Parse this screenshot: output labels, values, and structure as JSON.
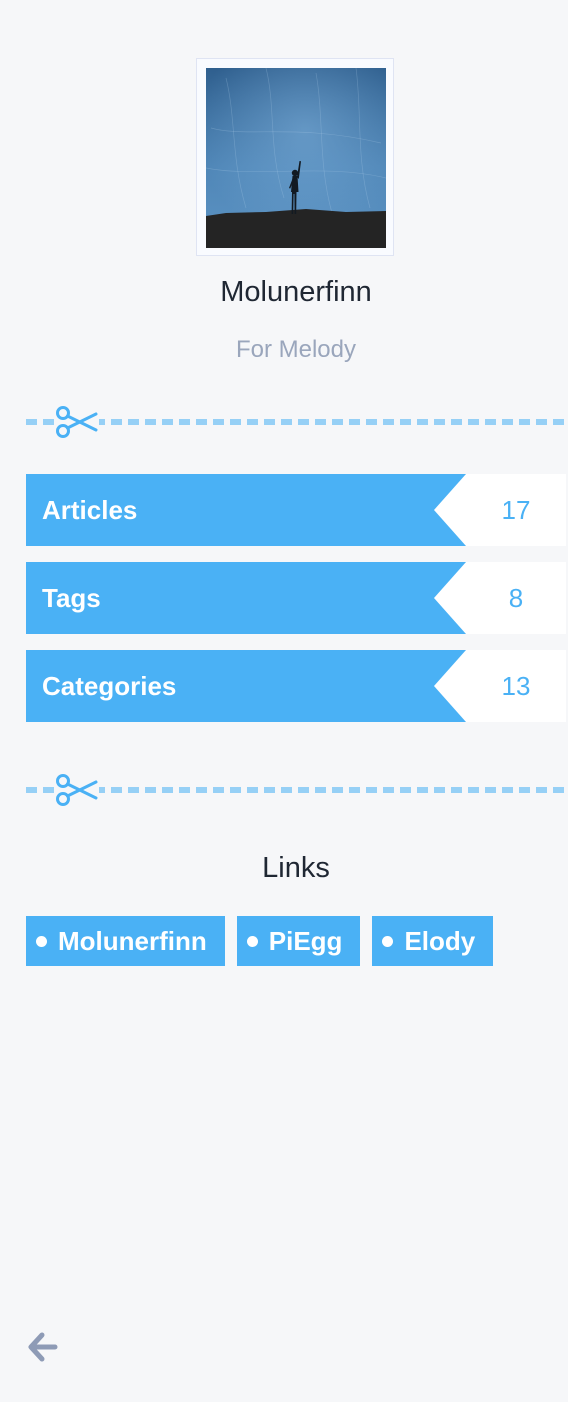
{
  "author": {
    "name": "Molunerfinn",
    "subtitle": "For Melody"
  },
  "stats": [
    {
      "label": "Articles",
      "count": "17"
    },
    {
      "label": "Tags",
      "count": "8"
    },
    {
      "label": "Categories",
      "count": "13"
    }
  ],
  "links": {
    "title": "Links",
    "items": [
      {
        "label": "Molunerfinn"
      },
      {
        "label": "PiEgg"
      },
      {
        "label": "Elody"
      }
    ]
  },
  "icons": {
    "divider": "scissors-icon",
    "back": "arrow-left-icon"
  },
  "colors": {
    "accent": "#4ab1f5",
    "divider": "#96d0f6",
    "background": "#f6f7f9",
    "text": "#1f2733",
    "muted_text": "#9aa6bc"
  }
}
